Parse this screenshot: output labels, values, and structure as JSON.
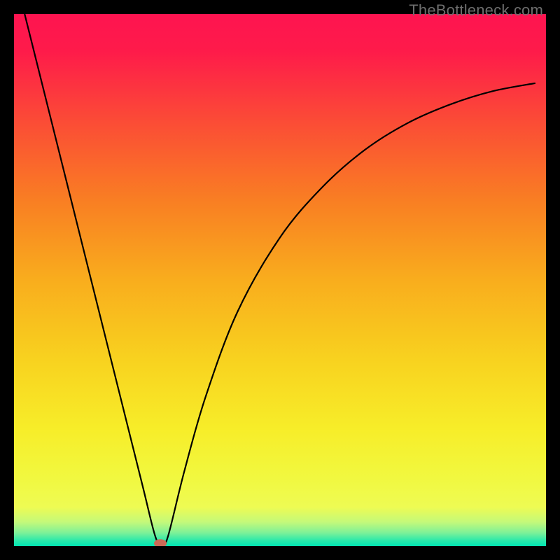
{
  "watermark": "TheBottleneck.com",
  "chart_data": {
    "type": "line",
    "title": "",
    "xlabel": "",
    "ylabel": "",
    "xlim": [
      0,
      100
    ],
    "ylim": [
      0,
      100
    ],
    "grid": false,
    "background_gradient": {
      "stops": [
        {
          "offset": 0.0,
          "color": "#fe1450"
        },
        {
          "offset": 0.07,
          "color": "#fe1b4a"
        },
        {
          "offset": 0.2,
          "color": "#fb4b36"
        },
        {
          "offset": 0.35,
          "color": "#f97e23"
        },
        {
          "offset": 0.5,
          "color": "#f9ad1d"
        },
        {
          "offset": 0.65,
          "color": "#f8d21f"
        },
        {
          "offset": 0.78,
          "color": "#f7ed29"
        },
        {
          "offset": 0.87,
          "color": "#f1f83f"
        },
        {
          "offset": 0.927,
          "color": "#eefb53"
        },
        {
          "offset": 0.955,
          "color": "#c4f97a"
        },
        {
          "offset": 0.975,
          "color": "#7ef198"
        },
        {
          "offset": 0.99,
          "color": "#29e9ab"
        },
        {
          "offset": 1.0,
          "color": "#02e5b2"
        }
      ]
    },
    "series": [
      {
        "name": "bottleneck-curve",
        "color": "#000000",
        "x": [
          2.0,
          10.0,
          18.0,
          24.0,
          26.5,
          27.8,
          29.0,
          32.0,
          36.0,
          42.0,
          50.0,
          58.0,
          66.0,
          74.0,
          82.0,
          90.0,
          98.0
        ],
        "y": [
          100.0,
          68.0,
          36.0,
          12.0,
          2.0,
          0.0,
          2.0,
          14.0,
          28.0,
          44.0,
          58.0,
          67.5,
          74.5,
          79.5,
          83.0,
          85.5,
          87.0
        ]
      }
    ],
    "marker": {
      "name": "marker-dot",
      "x": 27.5,
      "y": 0.5,
      "color": "#cb6a57",
      "rx": 9,
      "ry": 6
    }
  }
}
